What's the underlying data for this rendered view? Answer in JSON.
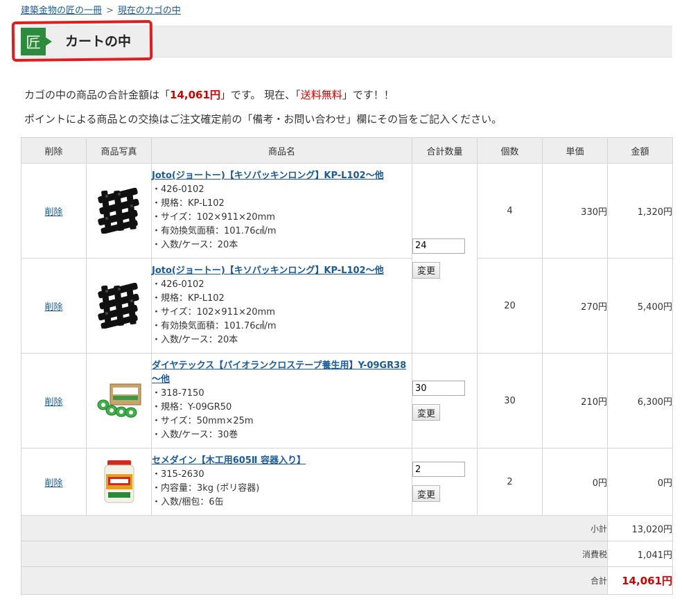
{
  "breadcrumb": {
    "home": "建築金物の匠の一冊",
    "separator": ">",
    "current": "現在のカゴの中"
  },
  "page_title": {
    "icon_char": "匠",
    "text": "カートの中"
  },
  "summary": {
    "prefix": "カゴの中の商品の合計金額は「",
    "total": "14,061円",
    "middle": "」です。 現在、「",
    "shipping": "送料無料",
    "suffix": "」です！！"
  },
  "notice": "ポイントによる商品との交換はご注文確定前の「備考・お問い合わせ」欄にその旨をご記入ください。",
  "table": {
    "headers": [
      "削除",
      "商品写真",
      "商品名",
      "合計数量",
      "個数",
      "単価",
      "金額"
    ],
    "delete_label": "削除",
    "change_label": "変更",
    "rows": [
      {
        "name": "Joto(ジョートー)【キソパッキンロング】KP-L102～他",
        "specs": [
          "・426-0102",
          "・規格：KP-L102",
          "・サイズ：102×911×20mm",
          "・有効換気面積：101.76㎠/m",
          "・入数/ケース：20本"
        ],
        "count": "4",
        "unit_price": "330円",
        "amount": "1,320円"
      },
      {
        "name": "Joto(ジョートー)【キソパッキンロング】KP-L102～他",
        "specs": [
          "・426-0102",
          "・規格：KP-L102",
          "・サイズ：102×911×20mm",
          "・有効換気面積：101.76㎠/m",
          "・入数/ケース：20本"
        ],
        "count": "20",
        "unit_price": "270円",
        "amount": "5,400円"
      },
      {
        "name": "ダイヤテックス【パイオランクロステープ養生用】Y-09GR38～他",
        "specs": [
          "・318-7150",
          "・規格：Y-09GR50",
          "・サイズ：50mm×25m",
          "・入数/ケース：30巻"
        ],
        "count": "30",
        "unit_price": "210円",
        "amount": "6,300円"
      },
      {
        "name": "セメダイン【木工用605Ⅱ 容器入り】",
        "specs": [
          "・315-2630",
          "・内容量：3kg (ポリ容器)",
          "・入数/梱包：6缶"
        ],
        "count": "2",
        "unit_price": "0円",
        "amount": "0円"
      }
    ],
    "qty_values": [
      "24",
      "30",
      "2"
    ],
    "totals": [
      {
        "label": "小計",
        "value": "13,020円"
      },
      {
        "label": "消費税",
        "value": "1,041円"
      },
      {
        "label": "合計",
        "value": "14,061円"
      }
    ]
  },
  "colors": {
    "accent_green": "#2e8a3c",
    "price_red": "#d40000",
    "link_blue": "#1a5a9a"
  }
}
